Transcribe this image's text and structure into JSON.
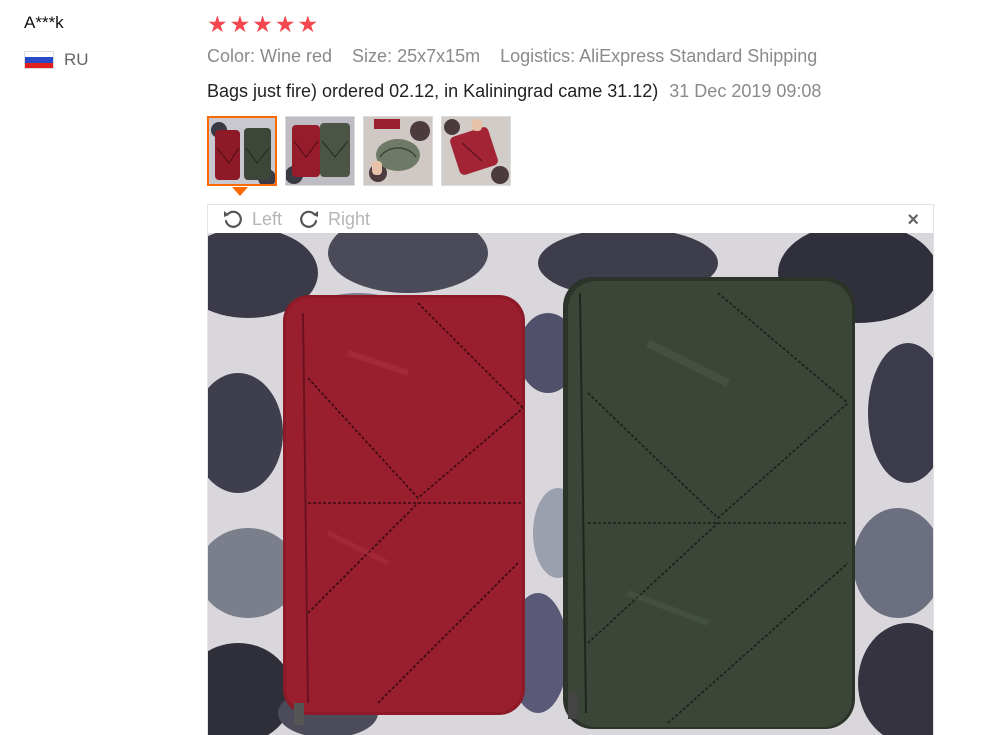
{
  "reviewer": {
    "name": "A***k",
    "country_code": "RU",
    "flag_colors": [
      "#ffffff",
      "#2a49c8",
      "#e02020"
    ]
  },
  "review": {
    "rating": 5,
    "rating_max": 5,
    "star_color": "#f5474f",
    "star_glyph": "★",
    "attributes": {
      "color": "Color: Wine red",
      "size": "Size: 25x7x15m",
      "logistics": "Logistics: AliExpress Standard Shipping"
    },
    "feedback_text": "Bags just fire) ordered 02.12, in Kaliningrad came 31.12)",
    "date": "31 Dec 2019 09:08"
  },
  "thumbnails": [
    {
      "icon": "photo-thumb-two-bags",
      "active": true
    },
    {
      "icon": "photo-thumb-two-bags-alt",
      "active": false
    },
    {
      "icon": "photo-thumb-bag-in-hand",
      "active": false
    },
    {
      "icon": "photo-thumb-red-bag",
      "active": false
    }
  ],
  "viewer": {
    "rotate_left_label": "Left",
    "rotate_right_label": "Right",
    "close_glyph": "×",
    "accent_color": "#ff6a00"
  }
}
